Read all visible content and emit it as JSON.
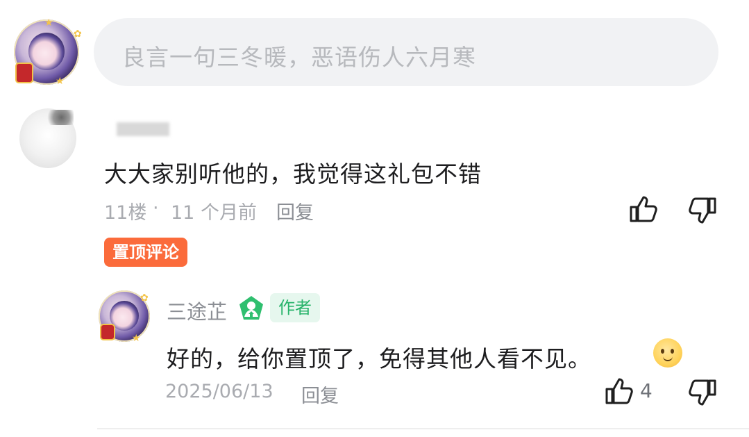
{
  "input": {
    "placeholder": "良言一句三冬暖，恶语伤人六月寒"
  },
  "main_comment": {
    "text": "大大家别听他的，我觉得这礼包不错",
    "floor": "11楼",
    "separator": "·",
    "time": "11 个月前",
    "reply_label": "回复",
    "pin_label": "置顶评论"
  },
  "author_reply": {
    "name": "三途芷",
    "role_tag": "作者",
    "text": "好的，给你置顶了，免得其他人看不见。",
    "emoji": "🙂",
    "date": "2025/06/13",
    "reply_label": "回复",
    "like_count": "4"
  },
  "colors": {
    "pin_tag_bg": "#fb6b3b",
    "author_tag_bg": "#e6f7ee",
    "author_tag_text": "#27b36a",
    "verified_badge": "#2fbf6f"
  }
}
